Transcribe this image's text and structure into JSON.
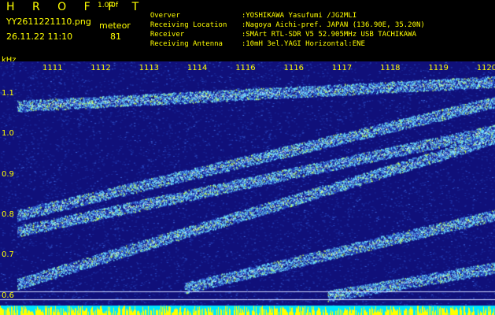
{
  "header": {
    "app_title": "H R O F F T",
    "app_version": "1.0.0f",
    "file_name": "YY2611221110.png",
    "date_time": "26.11.22 11:10",
    "meteor_label": "meteor",
    "meteor_count": "81"
  },
  "info": {
    "observer_key": "Overver",
    "observer_value": ":YOSHIKAWA Yasufumi /JG2MLI",
    "location_key": "Receiving Location",
    "location_value": ":Nagoya Aichi-pref. JAPAN (136.90E, 35.20N)",
    "receiver_key": "Receiver",
    "receiver_value": ":SMArt RTL-SDR V5 52.905MHz USB TACHIKAWA",
    "antenna_key": "Receiving Antenna",
    "antenna_value": ":10mH 3el.YAGI Horizontal:ENE"
  },
  "axis": {
    "y_unit": "kHz",
    "y_ticks": [
      "1.1",
      "1.0",
      "0.9",
      "0.8",
      "0.7",
      "0.6"
    ],
    "x_ticks": [
      "1111",
      "1112",
      "1113",
      "1114",
      "1116",
      "1116",
      "1117",
      "1118",
      "1119",
      "1120"
    ]
  },
  "chart_data": {
    "type": "heatmap",
    "ylabel": "kHz",
    "ylim": [
      0.58,
      1.18
    ],
    "x_tick_labels": [
      "1111",
      "1112",
      "1113",
      "1114",
      "1116",
      "1116",
      "1117",
      "1118",
      "1119",
      "1120"
    ],
    "y_tick_values": [
      1.1,
      1.0,
      0.9,
      0.8,
      0.7,
      0.6
    ],
    "traces": [
      {
        "x_start_min": 0.0,
        "f_start_khz": 1.07,
        "x_end_min": 10.0,
        "f_end_khz": 1.13
      },
      {
        "x_start_min": 0.0,
        "f_start_khz": 0.8,
        "x_end_min": 10.0,
        "f_end_khz": 1.08
      },
      {
        "x_start_min": 0.0,
        "f_start_khz": 0.76,
        "x_end_min": 10.0,
        "f_end_khz": 1.01
      },
      {
        "x_start_min": 0.0,
        "f_start_khz": 0.63,
        "x_end_min": 10.0,
        "f_end_khz": 0.99
      },
      {
        "x_start_min": 3.5,
        "f_start_khz": 0.62,
        "x_end_min": 10.0,
        "f_end_khz": 0.8
      },
      {
        "x_start_min": 6.5,
        "f_start_khz": 0.6,
        "x_end_min": 10.0,
        "f_end_khz": 0.67
      }
    ],
    "colors": {
      "background": "#10107a",
      "noise": "#2a4cc8",
      "signal": "#6fe0ff",
      "peak": "#c8ff5a",
      "baseline_bar": "#00e5ff",
      "baseline_spike": "#ffff00"
    }
  }
}
